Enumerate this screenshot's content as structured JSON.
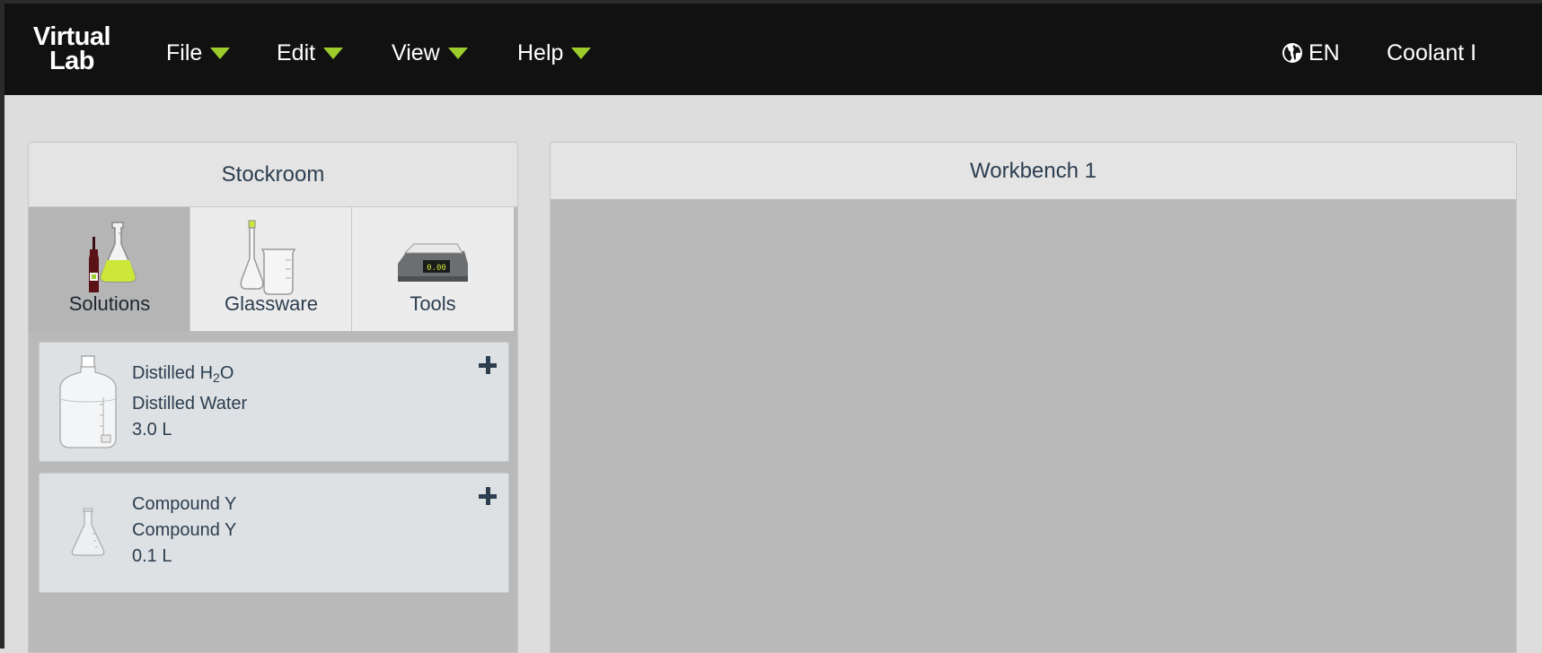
{
  "app": {
    "logo_line1": "Virtual",
    "logo_line2": "Lab"
  },
  "navbar": {
    "menus": [
      {
        "label": "File"
      },
      {
        "label": "Edit"
      },
      {
        "label": "View"
      },
      {
        "label": "Help"
      }
    ],
    "language": "EN",
    "user": "Coolant I"
  },
  "stockroom": {
    "title": "Stockroom",
    "active_tab": "Solutions",
    "tabs": [
      {
        "label": "Solutions",
        "icon": "solutions-icon"
      },
      {
        "label": "Glassware",
        "icon": "glassware-icon"
      },
      {
        "label": "Tools",
        "icon": "scale-icon"
      }
    ],
    "items": [
      {
        "formula_prefix": "Distilled H",
        "formula_subscript": "2",
        "formula_suffix": "O",
        "name": "Distilled Water",
        "volume": "3.0 L",
        "icon": "water-carboy-icon"
      },
      {
        "formula": "Compound Y",
        "name": "Compound Y",
        "volume": "0.1 L",
        "icon": "erlenmeyer-flask-icon"
      }
    ]
  },
  "workbench": {
    "title": "Workbench 1"
  },
  "colors": {
    "navbar_bg": "#111111",
    "accent": "#9ccc2c",
    "text_dark": "#2c3e50",
    "panel_bg": "#b9b9b9"
  }
}
